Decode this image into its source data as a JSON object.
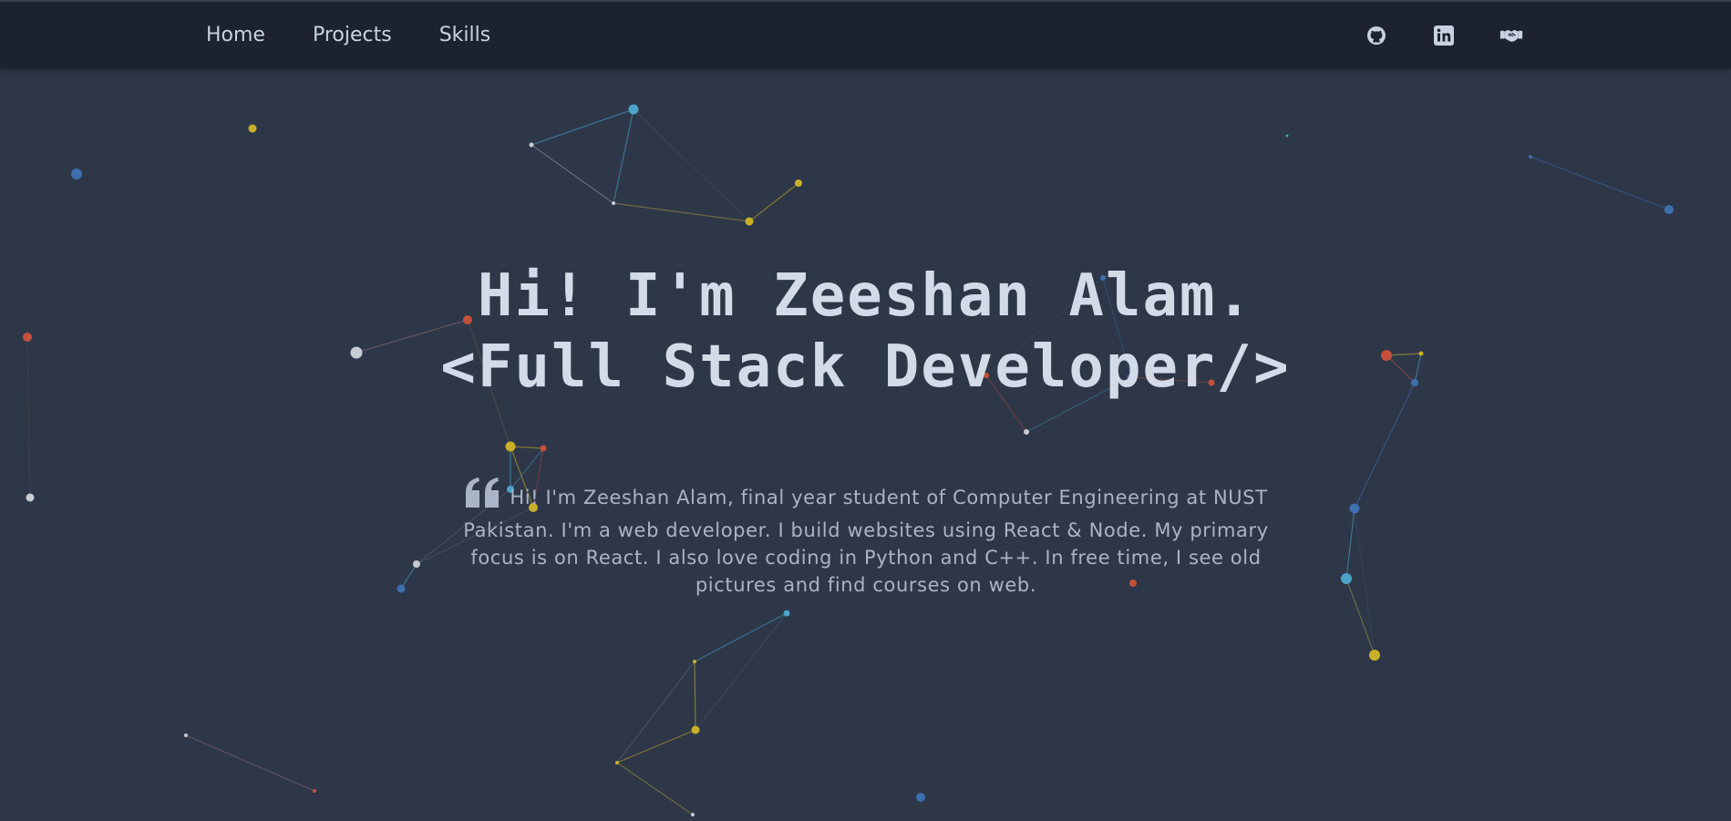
{
  "nav": {
    "links": [
      {
        "label": "Home"
      },
      {
        "label": "Projects"
      },
      {
        "label": "Skills"
      }
    ],
    "icons": [
      {
        "name": "github-icon"
      },
      {
        "name": "linkedin-icon"
      },
      {
        "name": "handshake-icon"
      }
    ]
  },
  "hero": {
    "line1": "Hi! I'm Zeeshan Alam.",
    "line2": "<Full Stack Developer/>"
  },
  "about": {
    "quote_icon": "quote-icon",
    "text": "Hi! I'm Zeeshan Alam, final year student of Computer Engineering at NUST Pakistan. I'm a web developer. I build websites using React & Node. My primary focus is on React. I also love coding in Python and C++. In free time, I see old pictures and find courses on web."
  },
  "colors": {
    "background": "#2e3748",
    "navbar": "#1c2230",
    "text": "#d3dbe8",
    "particle_blue": "#4aa3c8",
    "particle_yellow": "#c9b02a",
    "particle_red": "#c4503a",
    "particle_white": "#c8ccd4",
    "particle_navy": "#3d6fae"
  }
}
